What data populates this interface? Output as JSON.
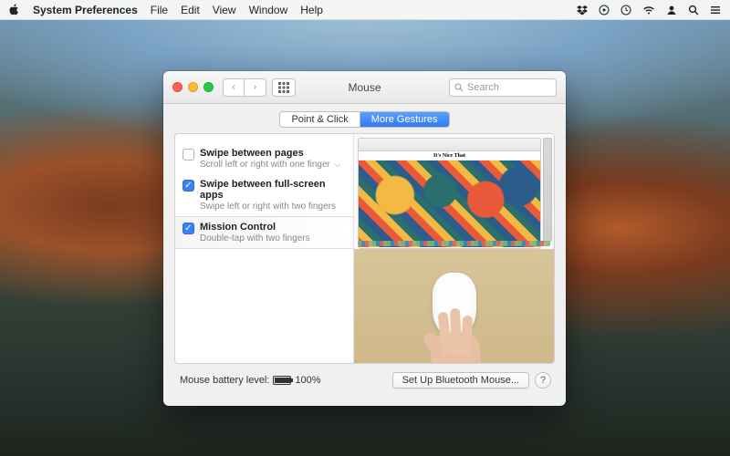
{
  "menubar": {
    "app": "System Preferences",
    "items": [
      "File",
      "Edit",
      "View",
      "Window",
      "Help"
    ]
  },
  "window": {
    "title": "Mouse",
    "search_placeholder": "Search",
    "tabs": {
      "left": "Point & Click",
      "right": "More Gestures"
    },
    "options": [
      {
        "checked": false,
        "title": "Swipe between pages",
        "subtitle": "Scroll left or right with one finger",
        "has_menu": true
      },
      {
        "checked": true,
        "title": "Swipe between full-screen apps",
        "subtitle": "Swipe left or right with two fingers",
        "has_menu": false
      },
      {
        "checked": true,
        "title": "Mission Control",
        "subtitle": "Double-tap with two fingers",
        "has_menu": false
      }
    ],
    "preview_title": "It's Nice That",
    "battery_label": "Mouse battery level:",
    "battery_value": "100%",
    "battery_pct": 100,
    "setup_button": "Set Up Bluetooth Mouse...",
    "help": "?"
  }
}
